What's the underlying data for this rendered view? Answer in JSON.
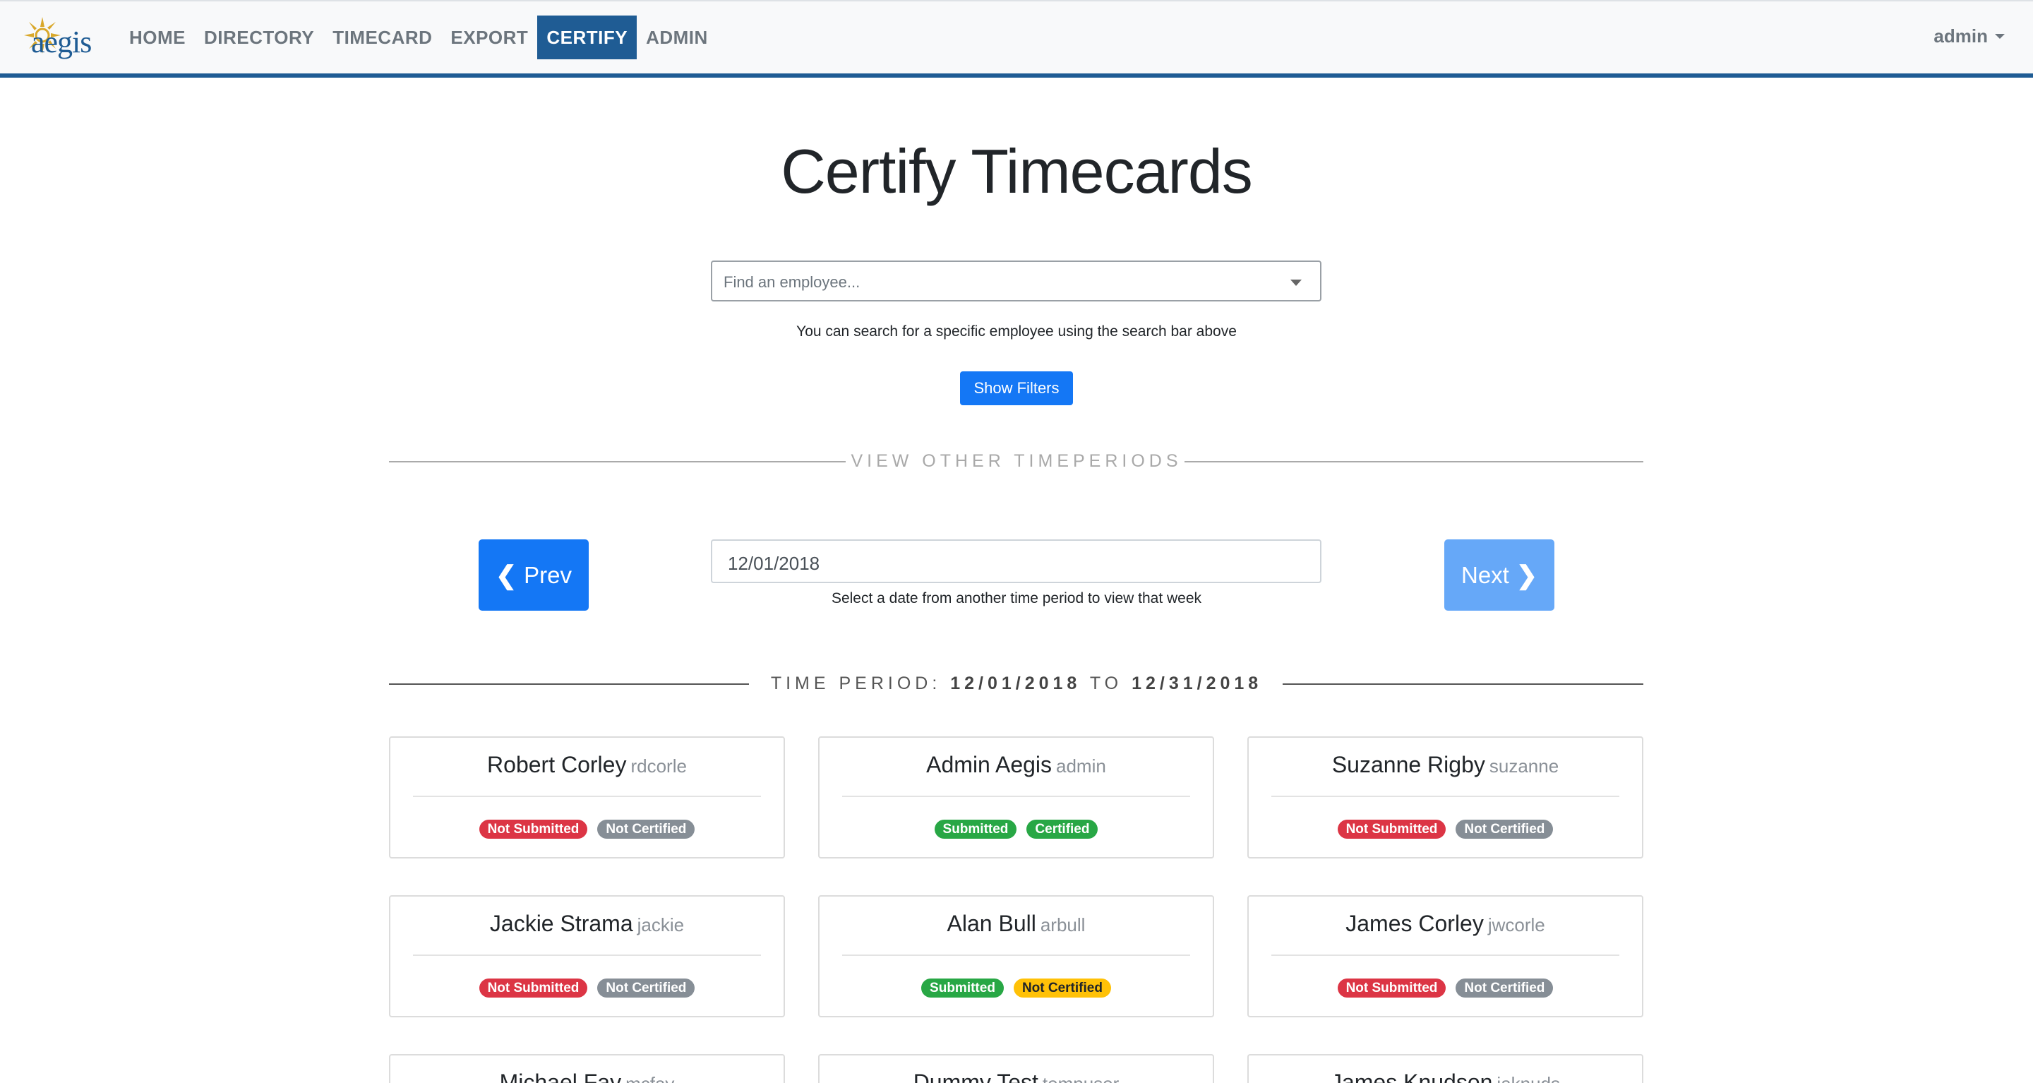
{
  "nav": {
    "logo_text": "aegis",
    "items": [
      {
        "label": "HOME"
      },
      {
        "label": "DIRECTORY"
      },
      {
        "label": "TIMECARD"
      },
      {
        "label": "EXPORT"
      },
      {
        "label": "CERTIFY",
        "active": true
      },
      {
        "label": "ADMIN"
      }
    ],
    "user": "admin"
  },
  "page": {
    "title": "Certify Timecards"
  },
  "search": {
    "placeholder": "Find an employee...",
    "help": "You can search for a specific employee using the search bar above",
    "filters_button": "Show Filters"
  },
  "timeperiods": {
    "divider_label": "VIEW OTHER TIMEPERIODS",
    "prev_label": "Prev",
    "next_label": "Next",
    "date_value": "12/01/2018",
    "date_help": "Select a date from another time period to view that week"
  },
  "period": {
    "prefix": "TIME PERIOD: ",
    "start": "12/01/2018",
    "to": " TO ",
    "end": "12/31/2018"
  },
  "employees": [
    {
      "name": "Robert Corley",
      "username": "rdcorle",
      "submitted": "Not Submitted",
      "certified": "Not Certified"
    },
    {
      "name": "Admin Aegis",
      "username": "admin",
      "submitted": "Submitted",
      "certified": "Certified"
    },
    {
      "name": "Suzanne Rigby",
      "username": "suzanne",
      "submitted": "Not Submitted",
      "certified": "Not Certified"
    },
    {
      "name": "Jackie Strama",
      "username": "jackie",
      "submitted": "Not Submitted",
      "certified": "Not Certified"
    },
    {
      "name": "Alan Bull",
      "username": "arbull",
      "submitted": "Submitted",
      "certified": "Not Certified"
    },
    {
      "name": "James Corley",
      "username": "jwcorle",
      "submitted": "Not Submitted",
      "certified": "Not Certified"
    },
    {
      "name": "Michael Fay",
      "username": "mcfay"
    },
    {
      "name": "Dummy Test",
      "username": "tempuser"
    },
    {
      "name": "James Knudson",
      "username": "jaknuds"
    }
  ],
  "colors": {
    "nav_active": "#1f5c94",
    "primary": "#1477f5",
    "badge_red": "#dc3545",
    "badge_gray": "#868e96",
    "badge_green": "#28a745",
    "badge_yellow": "#ffc107"
  }
}
